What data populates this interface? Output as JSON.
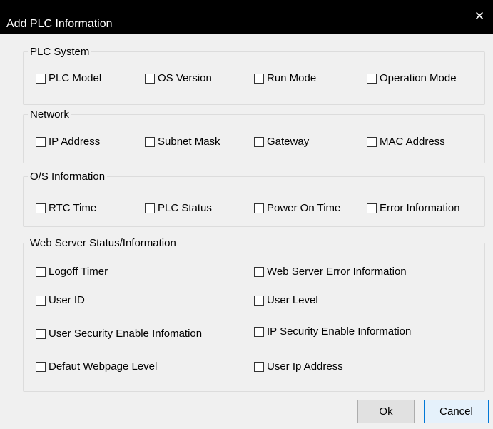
{
  "window": {
    "title": "Add PLC Information",
    "close_glyph": "✕"
  },
  "groups": {
    "plc_system": {
      "legend": "PLC System",
      "items": [
        "PLC Model",
        "OS Version",
        "Run Mode",
        "Operation Mode"
      ]
    },
    "network": {
      "legend": "Network",
      "items": [
        "IP Address",
        "Subnet Mask",
        "Gateway",
        "MAC Address"
      ]
    },
    "os_information": {
      "legend": "O/S Information",
      "items": [
        "RTC Time",
        "PLC Status",
        "Power On Time",
        "Error Information"
      ]
    },
    "web_server": {
      "legend": "Web Server Status/Information",
      "items": [
        "Logoff Timer",
        "Web Server Error Information",
        "User ID",
        "User Level",
        "User Security Enable Infomation",
        "IP Security Enable Information",
        "Defaut Webpage Level",
        "User Ip Address"
      ]
    }
  },
  "buttons": {
    "ok": "Ok",
    "cancel": "Cancel"
  },
  "colors": {
    "titlebar_bg": "#000000",
    "dialog_bg": "#f0f0f0",
    "default_button_border": "#0078d7"
  }
}
